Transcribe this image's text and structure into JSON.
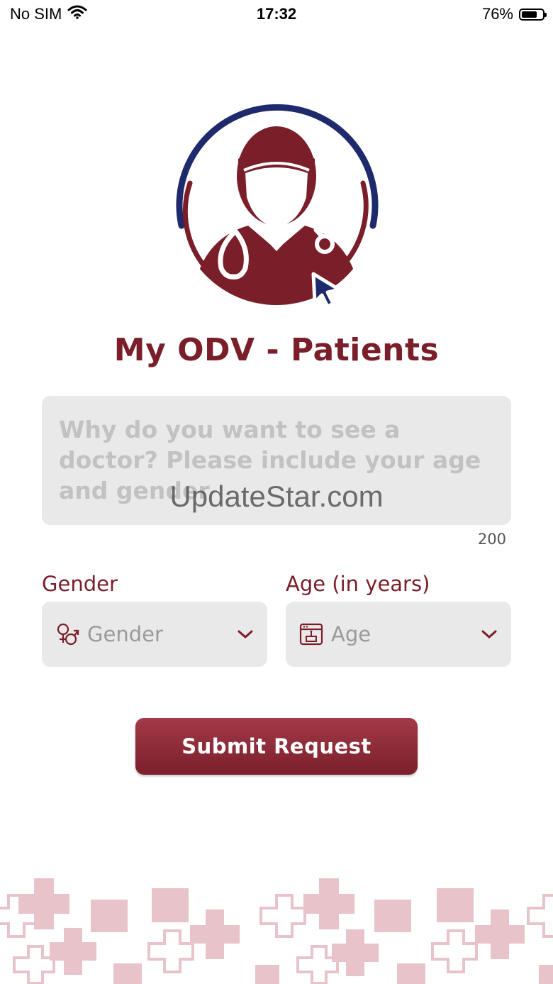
{
  "status_bar": {
    "carrier": "No SIM",
    "time": "17:32",
    "battery_percent": "76%",
    "battery_level": 0.76,
    "wifi_icon": "wifi-icon",
    "battery_icon": "battery-icon"
  },
  "app": {
    "title": "My ODV - Patients",
    "logo_icon": "doctor-logo-icon"
  },
  "reason": {
    "placeholder": "Why do you want to see a doctor? Please include your age and gender",
    "char_count": "200"
  },
  "watermark": "UpdateStar.com",
  "gender": {
    "label": "Gender",
    "placeholder": "Gender",
    "icon": "gender-icon"
  },
  "age": {
    "label": "Age (in years)",
    "placeholder": "Age",
    "icon": "birthday-cake-icon"
  },
  "submit": {
    "label": "Submit Request"
  },
  "colors": {
    "brand_maroon": "#7a1e29",
    "brand_navy": "#1e2a6b",
    "field_bg": "#e9e9e9",
    "pattern_pink": "#e8c4ca"
  }
}
